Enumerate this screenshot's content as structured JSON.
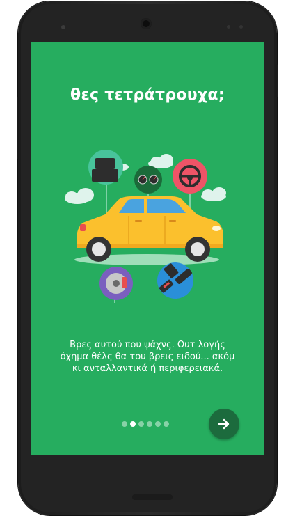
{
  "screen": {
    "title": "θες τετράτρουχα;",
    "description": "Βρες αυτού που ψάχνς. Ουτ λογής όχημα θέλς θα του βρεις ειδού... ακόμ κι ανταλλαντικά ή περιφερειακά.",
    "background_color": "#26ad5f"
  },
  "pager": {
    "total_pages": 6,
    "current_page": 2,
    "dots": [
      "page-1",
      "page-2",
      "page-3",
      "page-4",
      "page-5",
      "page-6"
    ]
  },
  "next_button": {
    "icon": "arrow-right-icon",
    "color": "#1c6b3d"
  },
  "illustration": {
    "subject": "yellow-car",
    "badges": [
      "car-seat-icon",
      "gauges-icon",
      "steering-wheel-icon",
      "brake-disc-icon",
      "seatbelt-icon"
    ]
  }
}
